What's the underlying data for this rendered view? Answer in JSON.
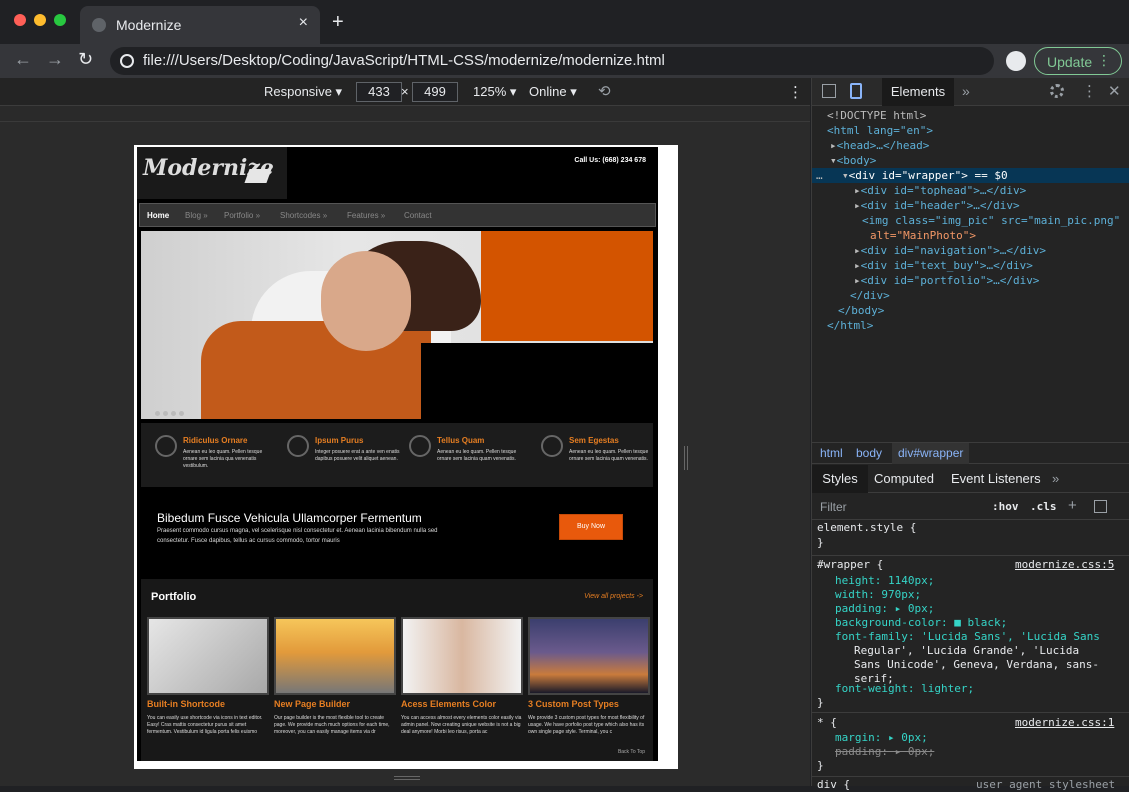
{
  "browser": {
    "tab_title": "Modernize",
    "tab_close": "×",
    "new_tab": "+",
    "url": "file:///Users/Desktop/Coding/JavaScript/HTML-CSS/modernize/modernize.html",
    "update_label": "Update",
    "update_menu": "⋮",
    "back": "←",
    "forward": "→",
    "reload": "↻"
  },
  "device_toolbar": {
    "mode": "Responsive ▾",
    "width": "433",
    "height": "499",
    "times": "×",
    "zoom": "125% ▾",
    "network": "Online ▾",
    "rotate": "⟲",
    "more": "⋮"
  },
  "site": {
    "logo": "Modernize",
    "call": "Call Us: (668) 234 678",
    "menu": [
      "Home",
      "Blog »",
      "Portfolio »",
      "Shortcodes »",
      "Features »",
      "Contact"
    ],
    "features": [
      {
        "title": "Ridiculus Ornare",
        "text": "Aenean eu leo quam. Pellen tesque ornare sem lacinia qua venenatis vestibulum."
      },
      {
        "title": "Ipsum Purus",
        "text": "Integer posuere erat a ante ven enatis dapibus posuere velit aliquet aenean."
      },
      {
        "title": "Tellus Quam",
        "text": "Aenean eu leo quam. Pellen tesque ornare sem lacinia quam venenatis."
      },
      {
        "title": "Sem Egestas",
        "text": "Aenean eu leo quam. Pellen tesque ornare sem lacinia quam venenatis."
      }
    ],
    "buy": {
      "title": "Bibedum Fusce Vehicula Ullamcorper Fermentum",
      "text": "Praesent commodo cursus magna, vel scelerisque nisl consectetur et. Aenean lacinia bibendum nulla sed consectetur. Fusce dapibus, tellus ac cursus commodo, tortor mauris",
      "button": "Buy Now"
    },
    "portfolio": {
      "title": "Portfolio",
      "view_all": "View all projects ->",
      "items": [
        {
          "title": "Built-in Shortcode",
          "text": "You can easily use shortcode via icons in text editor. Easy! Cras mattis consectetur purus sit amet fermentum. Vestibulum id ligula porta felis euismo"
        },
        {
          "title": "New Page Builder",
          "text": "Our page builder is the most flexible tool to create page. We provide much much options for each time, moreover, you can easily manage items via dr"
        },
        {
          "title": "Acess Elements Color",
          "text": "You can access almost every elements color easily via admin panel. Now creating unique website is not a big deal anymore! Morbi leo risus, porta ac"
        },
        {
          "title": "3 Custom Post Types",
          "text": "We provide 3 custom post types for most flexibility of usage. We have porfolio post type which also has its own single page style. Terminal, you c"
        }
      ],
      "back_to_top": "Back To Top"
    }
  },
  "devtools": {
    "tab_elements": "Elements",
    "more_tabs": "»",
    "dom": {
      "doctype": "<!DOCTYPE html>",
      "html_open": "<html lang=\"en\">",
      "head": "<head>…</head>",
      "body_open": "<body>",
      "wrapper": "<div id=\"wrapper\"> == $0",
      "tophead": "<div id=\"tophead\">…</div>",
      "header": "<div id=\"header\">…</div>",
      "img1": "<img class=\"img_pic\" src=\"main_pic.png\"",
      "img2": "alt=\"MainPhoto\">",
      "navigation": "<div id=\"navigation\">…</div>",
      "text_buy": "<div id=\"text_buy\">…</div>",
      "portfolio": "<div id=\"portfolio\">…</div>",
      "div_close": "</div>",
      "body_close": "</body>",
      "html_close": "</html>"
    },
    "crumbs": [
      "html",
      "body",
      "div#wrapper"
    ],
    "subtabs": [
      "Styles",
      "Computed",
      "Event Listeners",
      "»"
    ],
    "filter_placeholder": "Filter",
    "hov": ":hov",
    "cls": ".cls",
    "plus": "+",
    "rules": {
      "element_style": "element.style {",
      "close": "}",
      "wrapper_sel": "#wrapper {",
      "wrapper_src": "modernize.css:5",
      "height": "height: 1140px;",
      "width": "width: 970px;",
      "padding": "padding: ▸ 0px;",
      "bg": "background-color: ■ black;",
      "ff1": "font-family: 'Lucida Sans', 'Lucida Sans",
      "ff2": "Regular', 'Lucida Grande', 'Lucida",
      "ff3": "Sans Unicode', Geneva, Verdana, sans-",
      "ff4": "serif;",
      "fw": "font-weight: lighter;",
      "star_sel": "* {",
      "star_src": "modernize.css:1",
      "margin": "margin: ▸ 0px;",
      "padding_struck": "padding: ▸ 0px;",
      "div_sel": "div {",
      "ua": "user agent stylesheet"
    }
  }
}
